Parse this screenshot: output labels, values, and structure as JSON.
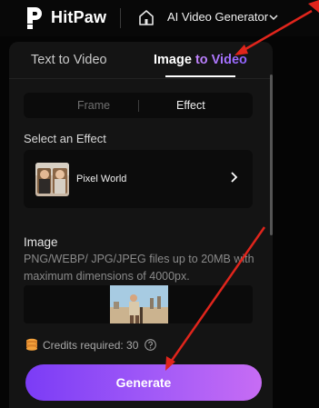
{
  "header": {
    "brand": "HitPaw",
    "app_selector": "AI Video Generator"
  },
  "tabs": [
    {
      "label": "Text to Video",
      "active": false
    },
    {
      "label_plain": "Image ",
      "label_accent": "to Video",
      "active": true
    }
  ],
  "mode_toggle": {
    "frame": "Frame",
    "effect": "Effect",
    "selected": "Effect"
  },
  "effect_section": {
    "label": "Select an Effect",
    "selected_effect": "Pixel World"
  },
  "image_section": {
    "label": "Image",
    "description": "PNG/WEBP/ JPG/JPEG files up to 20MB with maximum dimensions of 4000px."
  },
  "credits": {
    "text": "Credits required: 30"
  },
  "generate_button": "Generate",
  "colors": {
    "accent_start": "#7b3cf6",
    "accent_end": "#c76cf4",
    "annotation_red": "#e0251c",
    "panel_bg": "#141414"
  }
}
